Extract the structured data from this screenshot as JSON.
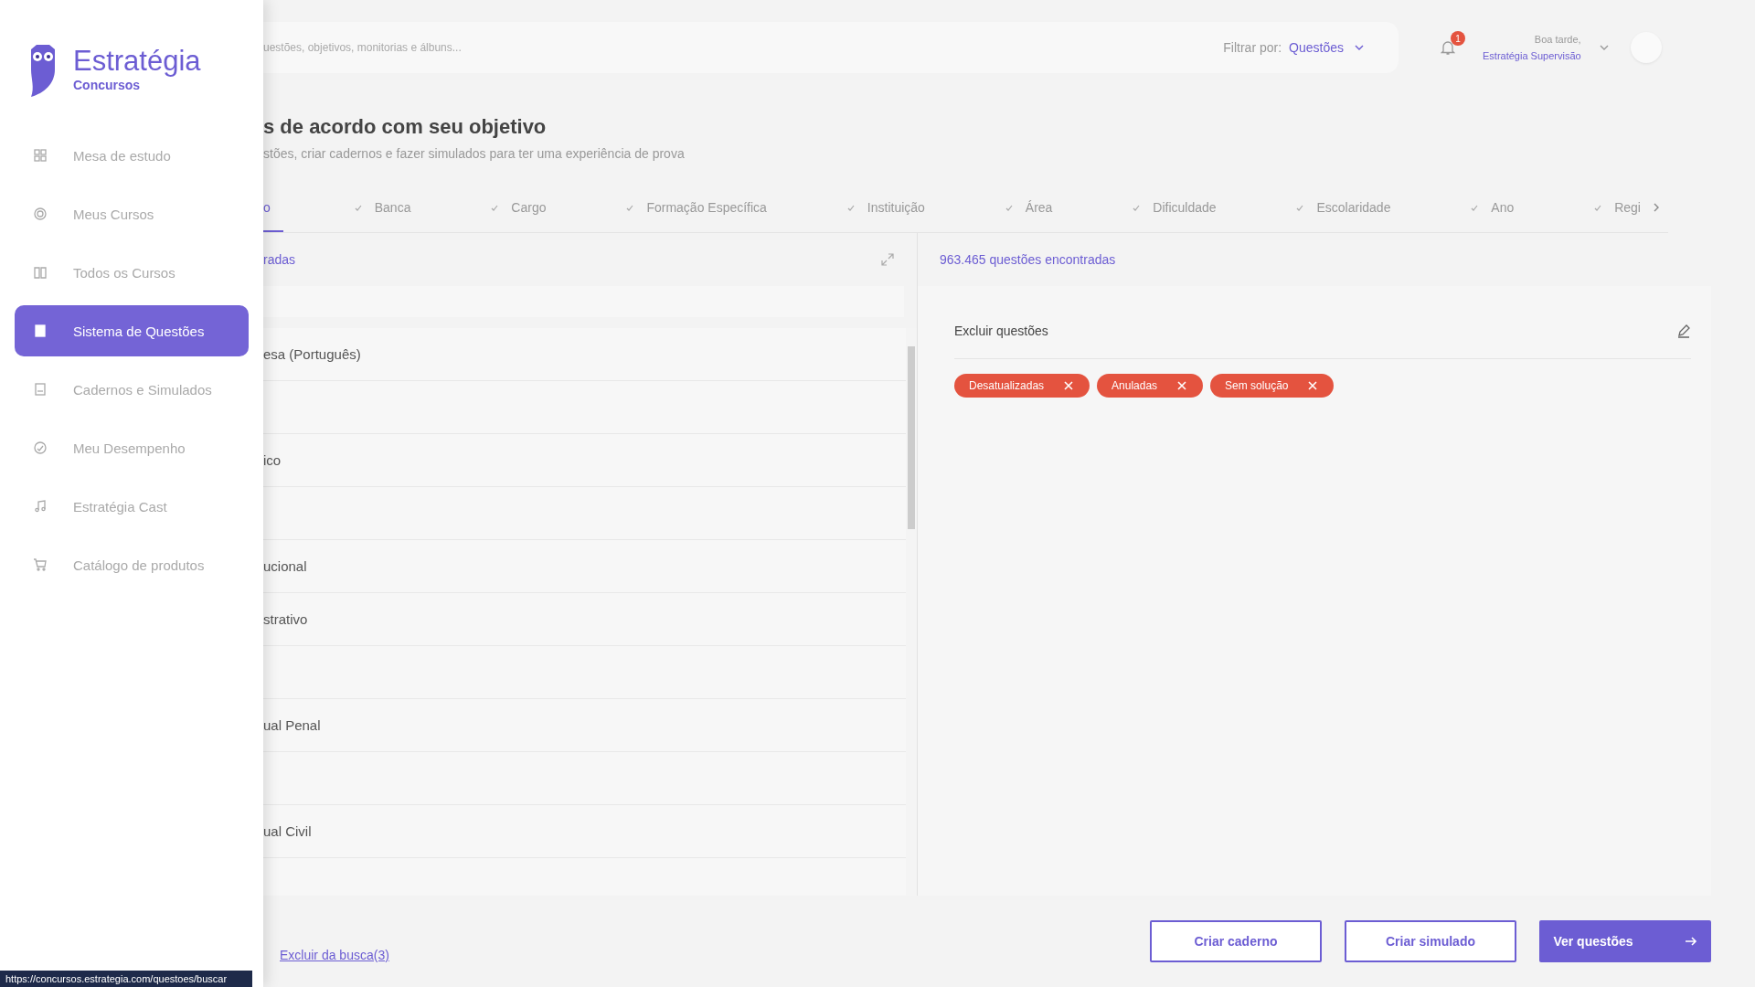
{
  "logo": {
    "name": "Estratégia",
    "sub": "Concursos"
  },
  "sidebar": {
    "items": [
      {
        "label": "Mesa de estudo",
        "selected": false
      },
      {
        "label": "Meus Cursos",
        "selected": false
      },
      {
        "label": "Todos os Cursos",
        "selected": false
      },
      {
        "label": "Sistema de Questões",
        "selected": true
      },
      {
        "label": "Cadernos e Simulados",
        "selected": false
      },
      {
        "label": "Meu Desempenho",
        "selected": false
      },
      {
        "label": "Estratégia Cast",
        "selected": false
      },
      {
        "label": "Catálogo de produtos",
        "selected": false
      }
    ]
  },
  "search": {
    "placeholder": "uestões, objetivos, monitorias e álbuns..."
  },
  "filter": {
    "label": "Filtrar por:",
    "value": "Questões"
  },
  "notifications": {
    "count": "1"
  },
  "user": {
    "greeting": "Boa tarde,",
    "name": "Estratégia Supervisão"
  },
  "heading": "s de acordo com seu objetivo",
  "subtitle": "stões, criar cadernos e fazer simulados para ter uma experiência de prova",
  "tabs": [
    {
      "label": "o",
      "selected": true,
      "checked": false
    },
    {
      "label": "Banca",
      "selected": false,
      "checked": true
    },
    {
      "label": "Cargo",
      "selected": false,
      "checked": true
    },
    {
      "label": "Formação Específica",
      "selected": false,
      "checked": true
    },
    {
      "label": "Instituição",
      "selected": false,
      "checked": true
    },
    {
      "label": "Área",
      "selected": false,
      "checked": true
    },
    {
      "label": "Dificuldade",
      "selected": false,
      "checked": true
    },
    {
      "label": "Escolaridade",
      "selected": false,
      "checked": true
    },
    {
      "label": "Ano",
      "selected": false,
      "checked": true
    },
    {
      "label": "Regi",
      "selected": false,
      "checked": true
    }
  ],
  "left_panel": {
    "title": "radas",
    "rows": [
      {
        "label": "esa (Português)"
      },
      {},
      {
        "label": "ico"
      },
      {},
      {
        "label": "ucional"
      },
      {
        "label": "strativo"
      },
      {},
      {
        "label": "ual Penal"
      },
      {},
      {
        "label": "ual Civil"
      },
      {}
    ]
  },
  "results": {
    "count": "963.465 questões encontradas",
    "section": "Excluir questões",
    "chips": [
      "Desatualizadas",
      "Anuladas",
      "Sem solução"
    ]
  },
  "bottom": {
    "link": "Excluir da busca(3)",
    "buttons": [
      {
        "label": "Criar caderno",
        "kind": "outline"
      },
      {
        "label": "Criar simulado",
        "kind": "outline"
      },
      {
        "label": "Ver questões",
        "kind": "primary"
      }
    ]
  },
  "status_bar": "https://concursos.estrategia.com/questoes/buscar"
}
